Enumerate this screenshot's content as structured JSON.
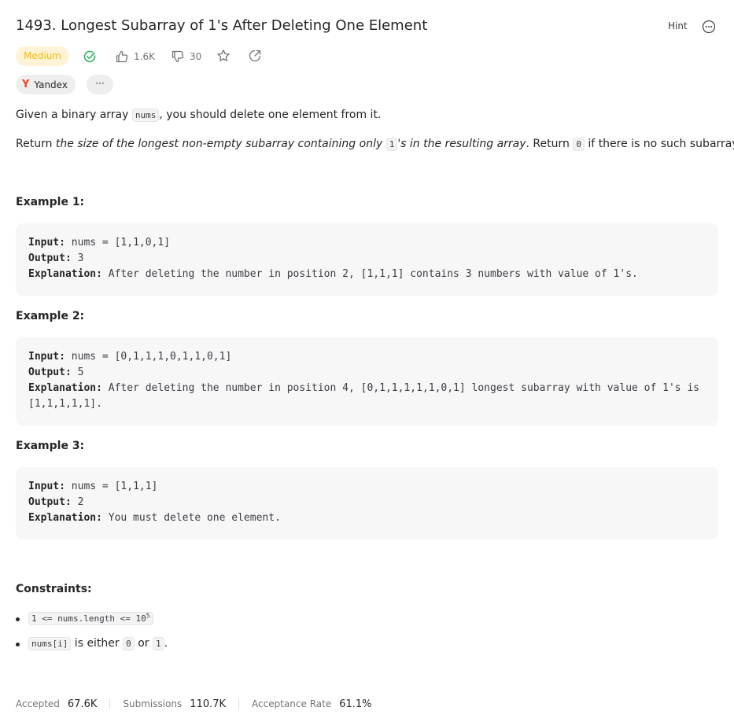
{
  "problem": {
    "title": "1493. Longest Subarray of 1's After Deleting One Element",
    "hint_label": "Hint",
    "difficulty": "Medium",
    "likes": "1.6K",
    "dislikes": "30",
    "company_tag": "Yandex",
    "more_tags_label": "···"
  },
  "description": {
    "p1_before": "Given a binary array ",
    "p1_code": "nums",
    "p1_after": ", you should delete one element from it.",
    "p2_return": "Return ",
    "p2_italic1": "the size of the longest non-empty subarray containing only ",
    "p2_code1": "1",
    "p2_italic2": "'s in the resulting array",
    "p2_mid": ". Return ",
    "p2_code2": "0",
    "p2_end": " if there is no such subarray."
  },
  "examples": [
    {
      "title": "Example 1:",
      "input_label": "Input:",
      "input": "nums = [1,1,0,1]",
      "output_label": "Output:",
      "output": "3",
      "explanation_label": "Explanation:",
      "explanation": "After deleting the number in position 2, [1,1,1] contains 3 numbers with value of 1's."
    },
    {
      "title": "Example 2:",
      "input_label": "Input:",
      "input": "nums = [0,1,1,1,0,1,1,0,1]",
      "output_label": "Output:",
      "output": "5",
      "explanation_label": "Explanation:",
      "explanation": "After deleting the number in position 4, [0,1,1,1,1,1,0,1] longest subarray with value of 1's is [1,1,1,1,1]."
    },
    {
      "title": "Example 3:",
      "input_label": "Input:",
      "input": "nums = [1,1,1]",
      "output_label": "Output:",
      "output": "2",
      "explanation_label": "Explanation:",
      "explanation": "You must delete one element."
    }
  ],
  "constraints": {
    "title": "Constraints:",
    "c1_code": "1 <= nums.length <= 10",
    "c1_sup": "5",
    "c2_code": "nums[i]",
    "c2_text1": " is either ",
    "c2_code_a": "0",
    "c2_text2": " or ",
    "c2_code_b": "1",
    "c2_text3": "."
  },
  "stats": {
    "accepted_label": "Accepted",
    "accepted_value": "67.6K",
    "submissions_label": "Submissions",
    "submissions_value": "110.7K",
    "rate_label": "Acceptance Rate",
    "rate_value": "61.1%"
  },
  "colors": {
    "medium": "#ffb800",
    "medium_bg": "#fef3d6",
    "solved": "#2db55d",
    "yandex": "#fc3f1d"
  },
  "icons": [
    "more-options-icon",
    "solved-check-icon",
    "thumbs-up-icon",
    "thumbs-down-icon",
    "star-icon",
    "share-icon",
    "yandex-logo-icon"
  ]
}
